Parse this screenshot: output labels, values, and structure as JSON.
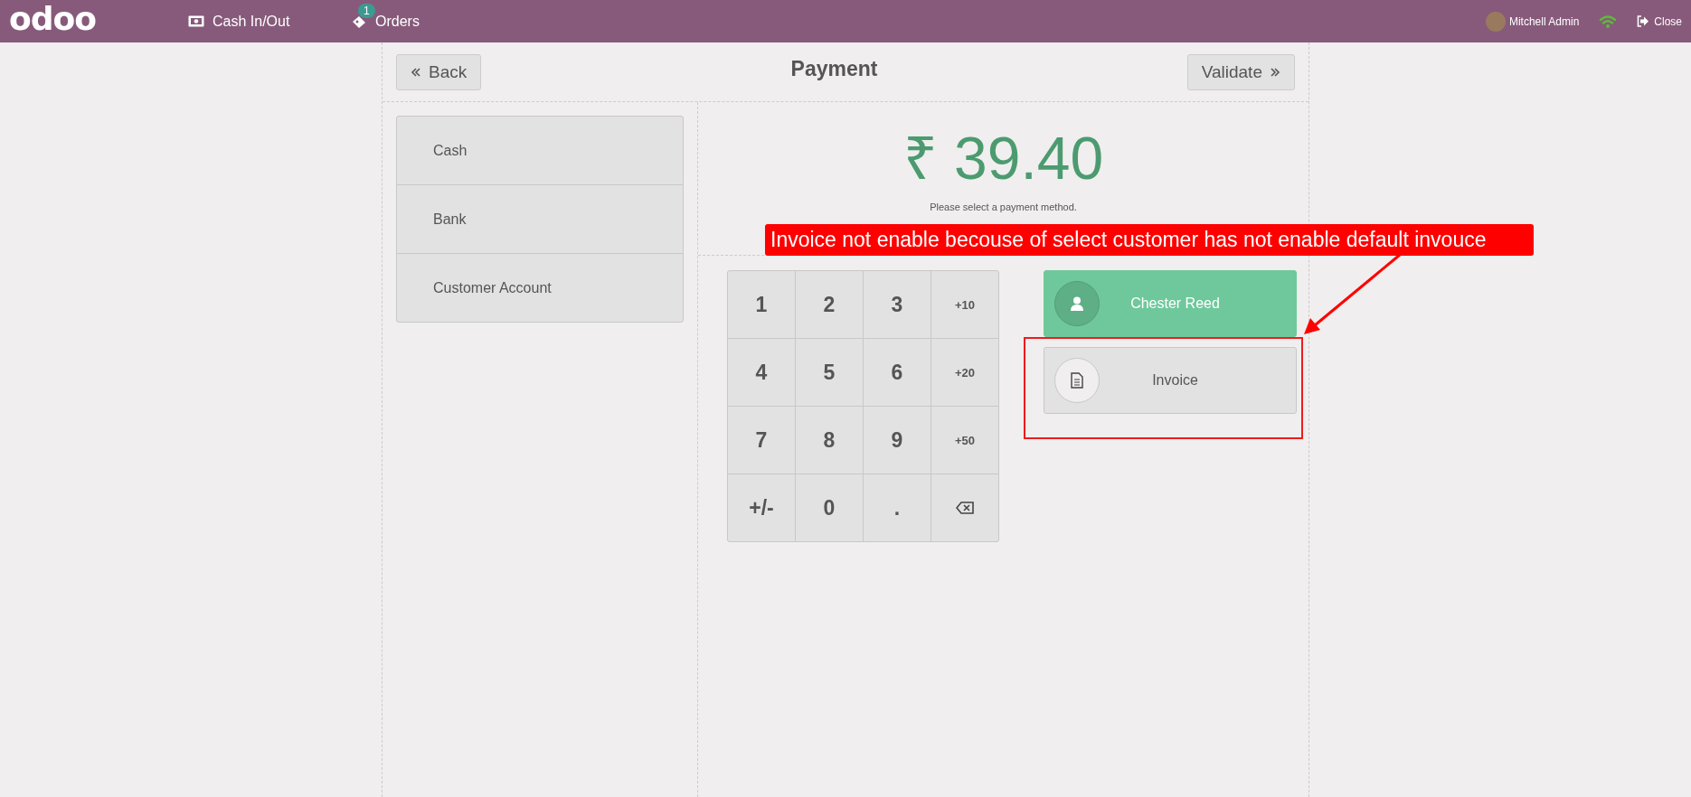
{
  "navbar": {
    "logo": "odoo",
    "items": [
      {
        "kind": "cash",
        "label": "Cash In/Out"
      },
      {
        "kind": "orders",
        "label": "Orders",
        "badge": "1"
      }
    ],
    "user": "Mitchell Admin",
    "close": "Close"
  },
  "header": {
    "back": "Back",
    "title": "Payment",
    "validate": "Validate"
  },
  "payment_methods": [
    "Cash",
    "Bank",
    "Customer Account"
  ],
  "amount": "₹ 39.40",
  "message": "Please select a payment method.",
  "numpad": [
    {
      "kind": "digit",
      "label": "1"
    },
    {
      "kind": "digit",
      "label": "2"
    },
    {
      "kind": "digit",
      "label": "3"
    },
    {
      "kind": "add",
      "label": "+10"
    },
    {
      "kind": "digit",
      "label": "4"
    },
    {
      "kind": "digit",
      "label": "5"
    },
    {
      "kind": "digit",
      "label": "6"
    },
    {
      "kind": "add",
      "label": "+20"
    },
    {
      "kind": "digit",
      "label": "7"
    },
    {
      "kind": "digit",
      "label": "8"
    },
    {
      "kind": "digit",
      "label": "9"
    },
    {
      "kind": "add",
      "label": "+50"
    },
    {
      "kind": "digit",
      "label": "+/-"
    },
    {
      "kind": "digit",
      "label": "0"
    },
    {
      "kind": "digit",
      "label": "."
    },
    {
      "kind": "backspace"
    }
  ],
  "options": [
    {
      "kind": "customer",
      "label": "Chester Reed",
      "selected": true
    },
    {
      "kind": "invoice",
      "label": "Invoice",
      "selected": false
    }
  ],
  "annotation": {
    "text": "Invoice not enable becouse of select customer has not enable default invouce"
  }
}
